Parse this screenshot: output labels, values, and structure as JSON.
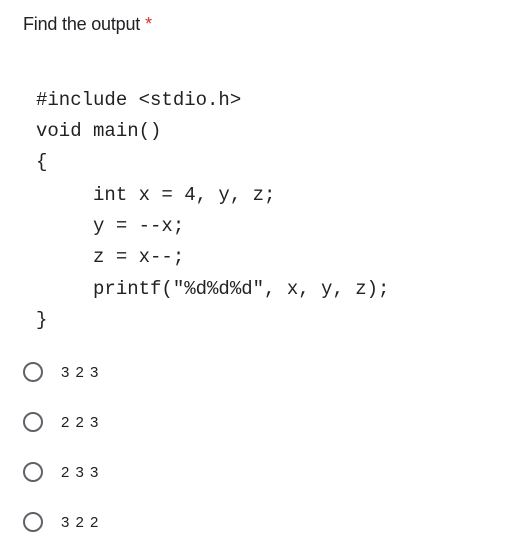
{
  "question": {
    "title": "Find the output",
    "required_marker": "*"
  },
  "code_lines": [
    "#include <stdio.h>",
    "void main()",
    "{",
    "     int x = 4, y, z;",
    "     y = --x;",
    "     z = x--;",
    "     printf(\"%d%d%d\", x, y, z);",
    "}"
  ],
  "options": [
    {
      "label": "3 2 3",
      "selected": false
    },
    {
      "label": "2 2 3",
      "selected": false
    },
    {
      "label": "2 3 3",
      "selected": false
    },
    {
      "label": "3 2 2",
      "selected": false
    }
  ]
}
